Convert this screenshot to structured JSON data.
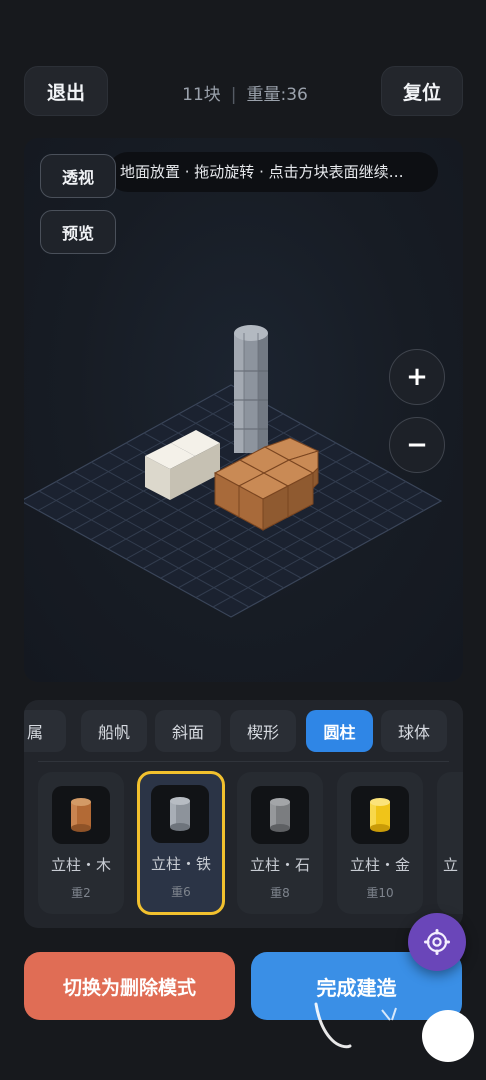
{
  "header": {
    "exit_label": "退出",
    "reset_label": "复位",
    "block_count": "11块",
    "separator": "|",
    "weight": "重量:36"
  },
  "viewport": {
    "hint": "地面放置 · 拖动旋转 · 点击方块表面继续…",
    "perspective_label": "透视",
    "preview_label": "预览",
    "zoom_in_label": "+",
    "zoom_out_label": "−"
  },
  "palette": {
    "tabs": [
      {
        "label": "属",
        "active": false
      },
      {
        "label": "船帆",
        "active": false
      },
      {
        "label": "斜面",
        "active": false
      },
      {
        "label": "楔形",
        "active": false
      },
      {
        "label": "圆柱",
        "active": true
      },
      {
        "label": "球体",
        "active": false
      }
    ],
    "items": [
      {
        "name": "立柱・木",
        "weight": "重2",
        "color": "#b36a35",
        "selected": false
      },
      {
        "name": "立柱・铁",
        "weight": "重6",
        "color": "#8d939b",
        "selected": true
      },
      {
        "name": "立柱・石",
        "weight": "重8",
        "color": "#7b7d80",
        "selected": false
      },
      {
        "name": "立柱・金",
        "weight": "重10",
        "color": "#f0c419",
        "selected": false
      },
      {
        "name": "立",
        "weight": "",
        "color": "#555",
        "selected": false
      }
    ]
  },
  "actions": {
    "delete_mode_label": "切换为删除模式",
    "finish_label": "完成建造"
  },
  "colors": {
    "accent": "#2f86e6",
    "selected_border": "#f2c12e",
    "delete": "#e06d55",
    "finish": "#3a8fe6",
    "fab": "#6a46b9"
  },
  "icons": {
    "settings": "gear-icon",
    "touch": "hand-pointer-icon"
  }
}
